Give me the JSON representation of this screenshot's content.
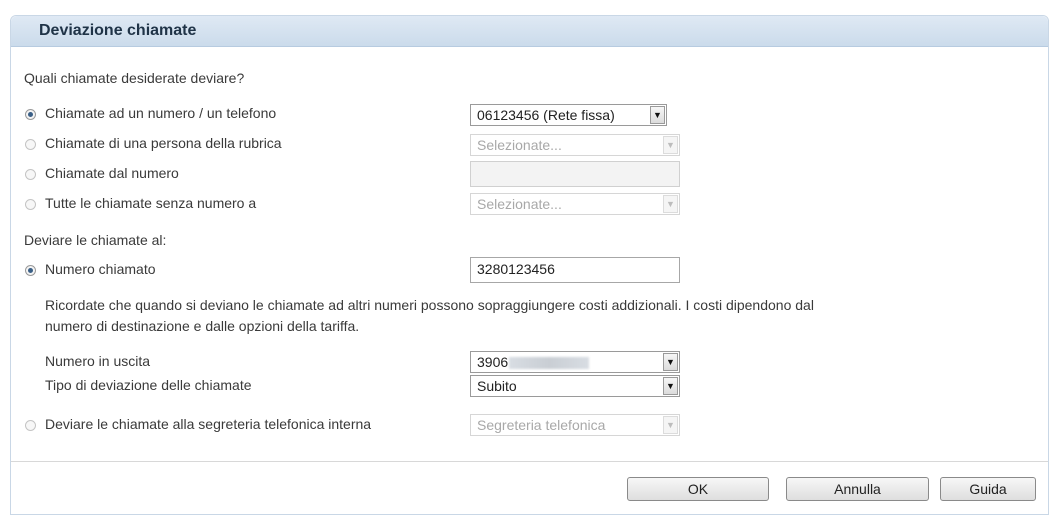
{
  "panel": {
    "title": "Deviazione chiamate"
  },
  "section_which": {
    "question": "Quali chiamate desiderate deviare?",
    "options": [
      {
        "label": "Chiamate ad un numero / un telefono",
        "selected": true,
        "control": "select",
        "value": "06123456 (Rete fissa)",
        "enabled": true
      },
      {
        "label": "Chiamate di una persona della rubrica",
        "selected": false,
        "control": "select",
        "value": "Selezionate...",
        "enabled": false
      },
      {
        "label": "Chiamate dal numero",
        "selected": false,
        "control": "input",
        "value": "",
        "enabled": false
      },
      {
        "label": "Tutte le chiamate senza numero a",
        "selected": false,
        "control": "select",
        "value": "Selezionate...",
        "enabled": false
      }
    ]
  },
  "section_target": {
    "heading": "Deviare le chiamate al:",
    "numero_chiamato": {
      "label": "Numero chiamato",
      "selected": true,
      "value": "3280123456"
    },
    "notice_line1": "Ricordate che quando si deviano le chiamate ad altri numeri possono sopraggiungere costi addizionali. I costi dipendono dal",
    "notice_line2": "numero di destinazione e dalle opzioni della tariffa.",
    "numero_uscita": {
      "label": "Numero in uscita",
      "value": "3906"
    },
    "tipo_deviazione": {
      "label": "Tipo di deviazione delle chiamate",
      "value": "Subito"
    },
    "segreteria": {
      "label": "Deviare le chiamate alla segreteria telefonica interna",
      "selected": false,
      "value": "Segreteria telefonica"
    }
  },
  "buttons": {
    "ok": "OK",
    "cancel": "Annulla",
    "help": "Guida"
  },
  "icons": {
    "dropdown": "chevron-down-icon"
  },
  "colors": {
    "header_bg": "#cbdbeb",
    "radio_selected": "#3a5f86"
  }
}
